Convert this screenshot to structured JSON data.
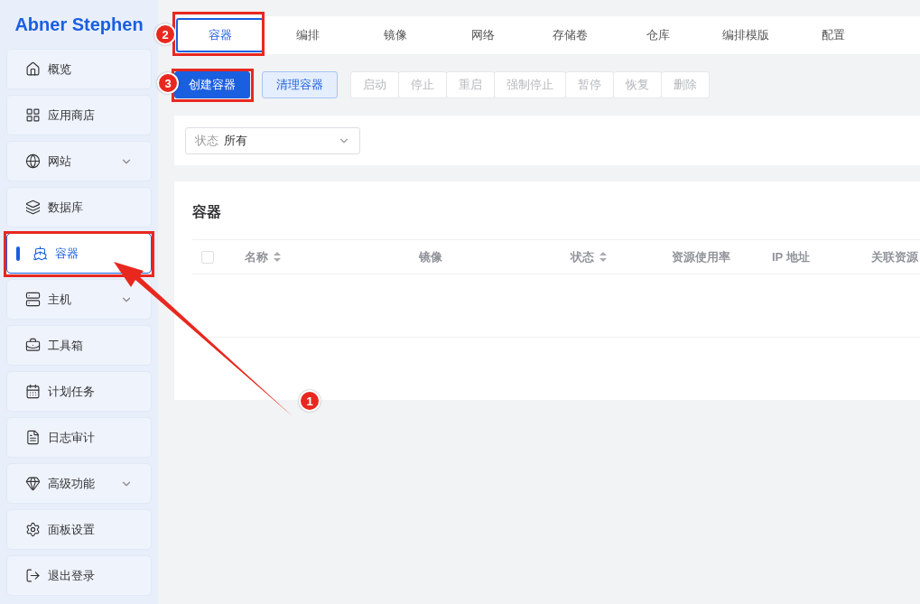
{
  "sidebar": {
    "brand": "Abner Stephen",
    "items": [
      {
        "label": "概览",
        "expandable": false,
        "selected": false
      },
      {
        "label": "应用商店",
        "expandable": false,
        "selected": false
      },
      {
        "label": "网站",
        "expandable": true,
        "selected": false
      },
      {
        "label": "数据库",
        "expandable": false,
        "selected": false
      },
      {
        "label": "容器",
        "expandable": false,
        "selected": true
      },
      {
        "label": "主机",
        "expandable": true,
        "selected": false
      },
      {
        "label": "工具箱",
        "expandable": false,
        "selected": false
      },
      {
        "label": "计划任务",
        "expandable": false,
        "selected": false
      },
      {
        "label": "日志审计",
        "expandable": false,
        "selected": false
      },
      {
        "label": "高级功能",
        "expandable": true,
        "selected": false
      },
      {
        "label": "面板设置",
        "expandable": false,
        "selected": false
      },
      {
        "label": "退出登录",
        "expandable": false,
        "selected": false
      }
    ]
  },
  "tabs": [
    {
      "label": "容器",
      "selected": true
    },
    {
      "label": "编排",
      "selected": false
    },
    {
      "label": "镜像",
      "selected": false
    },
    {
      "label": "网络",
      "selected": false
    },
    {
      "label": "存储卷",
      "selected": false
    },
    {
      "label": "仓库",
      "selected": false
    },
    {
      "label": "编排模版",
      "selected": false
    },
    {
      "label": "配置",
      "selected": false
    }
  ],
  "actions": [
    {
      "label": "创建容器",
      "kind": "primary",
      "disabled": false
    },
    {
      "label": "清理容器",
      "kind": "secondary",
      "disabled": false
    },
    {
      "label": "启动",
      "kind": "group",
      "disabled": true
    },
    {
      "label": "停止",
      "kind": "group",
      "disabled": true
    },
    {
      "label": "重启",
      "kind": "group",
      "disabled": true
    },
    {
      "label": "强制停止",
      "kind": "group",
      "disabled": true
    },
    {
      "label": "暂停",
      "kind": "group",
      "disabled": true
    },
    {
      "label": "恢复",
      "kind": "group",
      "disabled": true
    },
    {
      "label": "删除",
      "kind": "group",
      "disabled": true
    }
  ],
  "filter": {
    "label": "状态",
    "value": "所有"
  },
  "table": {
    "title": "容器",
    "select_all_checked": false,
    "columns": [
      {
        "label": "名称",
        "sortable": true
      },
      {
        "label": "镜像",
        "sortable": false
      },
      {
        "label": "状态",
        "sortable": true
      },
      {
        "label": "资源使用率",
        "sortable": false
      },
      {
        "label": "IP 地址",
        "sortable": false
      },
      {
        "label": "关联资源",
        "sortable": false
      }
    ]
  },
  "annotations": {
    "badges": [
      {
        "label": "1"
      },
      {
        "label": "2"
      },
      {
        "label": "3"
      }
    ]
  }
}
